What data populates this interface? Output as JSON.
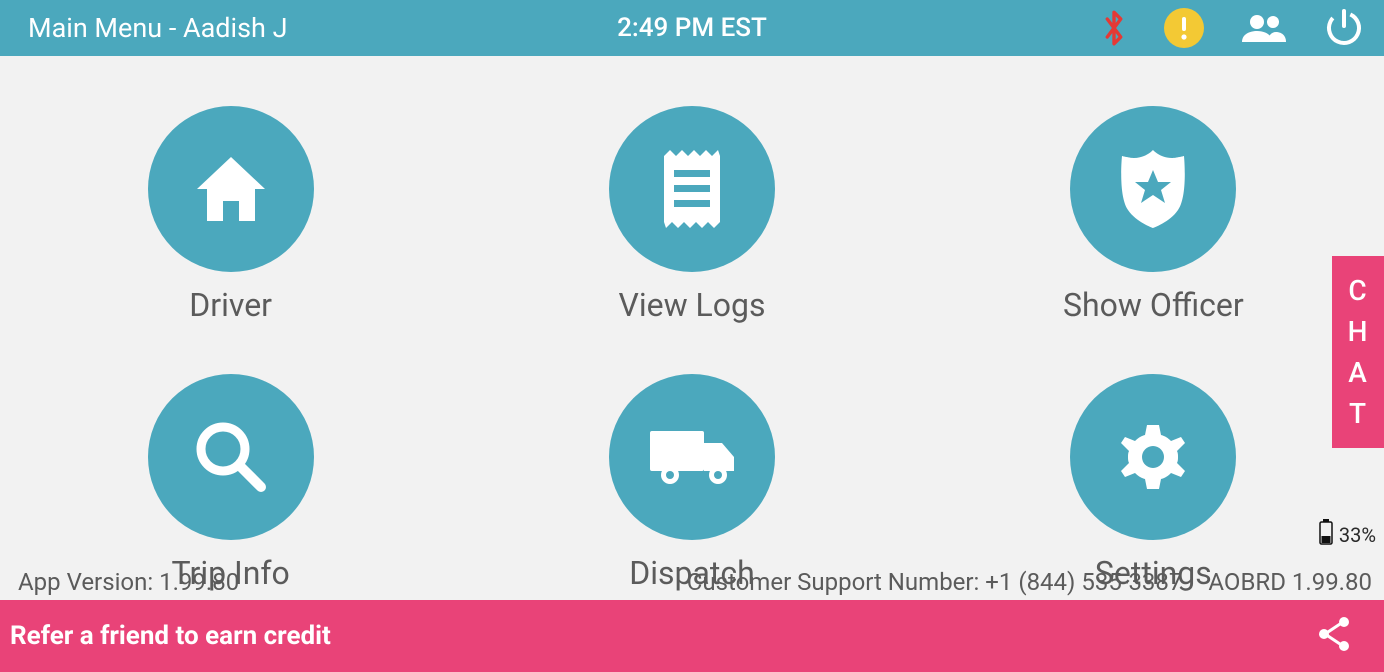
{
  "header": {
    "title": "Main Menu - Aadish J",
    "time": "2:49 PM EST"
  },
  "battery": {
    "percent": "33%"
  },
  "tiles": {
    "driver": "Driver",
    "view_logs": "View Logs",
    "show_officer": "Show Officer",
    "trip_info": "Trip Info",
    "dispatch": "Dispatch",
    "settings": "Settings"
  },
  "chat": {
    "c": "C",
    "h": "H",
    "a": "A",
    "t": "T"
  },
  "info": {
    "app_version": "App Version: 1.99.80",
    "support": "Customer Support Number: +1 (844) 535-3387",
    "aobrd": "AOBRD 1.99.80"
  },
  "footer": {
    "refer": "Refer a friend to earn credit"
  }
}
